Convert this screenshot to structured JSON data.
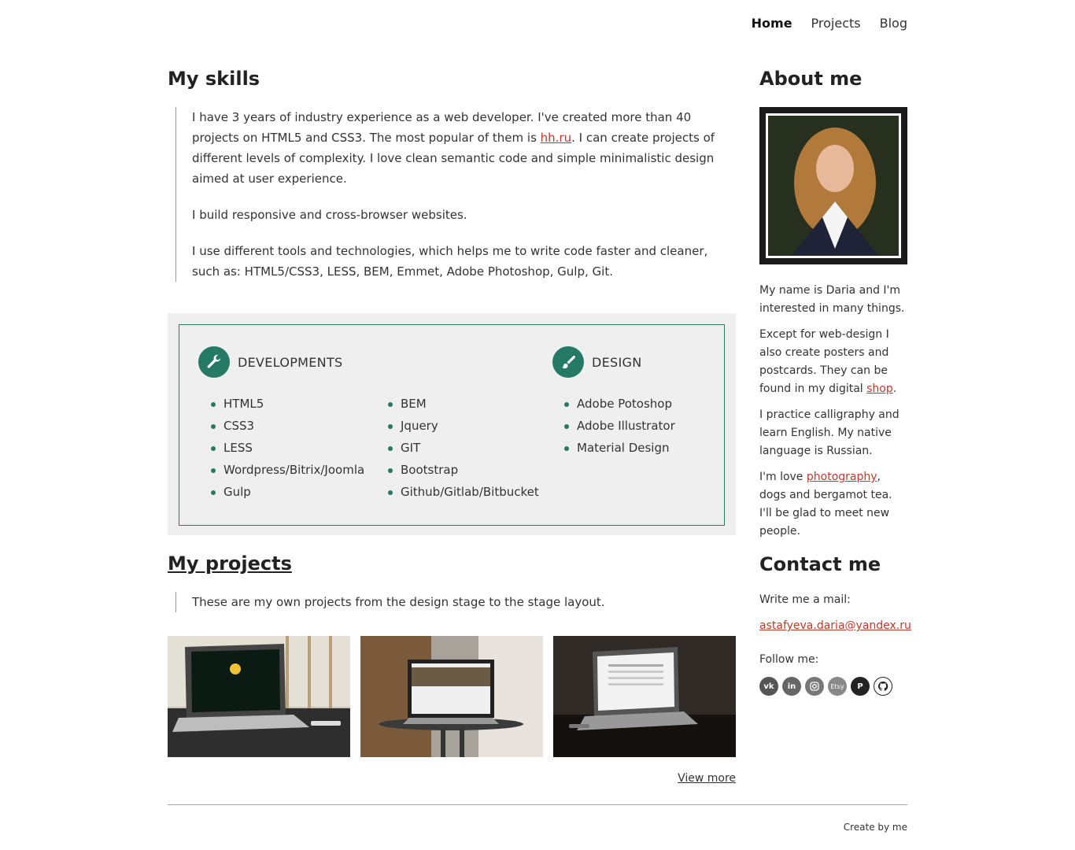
{
  "nav": {
    "home": "Home",
    "projects": "Projects",
    "blog": "Blog"
  },
  "skills": {
    "title": "My skills",
    "p1_before": "I have 3 years of industry experience as a web developer. I've created more than 40 projects on HTML5 and CSS3. The most popular of them is ",
    "p1_link": "hh.ru",
    "p1_after": ". I can create projects of different levels of complexity. I love clean semantic code and simple minimalistic design aimed at user experience.",
    "p2": "I build responsive and cross-browser websites.",
    "p3": "I use different tools and technologies, which helps me to write code faster and cleaner, such as: HTML5/CSS3, LESS, BEM, Emmet, Adobe Photoshop, Gulp, Git."
  },
  "box": {
    "dev_title": "DEVELOPMENTS",
    "design_title": "DESIGN",
    "dev_col1": [
      "HTML5",
      "CSS3",
      "LESS",
      "Wordpress/Bitrix/Joomla",
      "Gulp"
    ],
    "dev_col2": [
      "BEM",
      "Jquery",
      "GIT",
      "Bootstrap",
      "Github/Gitlab/Bitbucket"
    ],
    "design": [
      "Adobe Potoshop",
      "Adobe Illustrator",
      "Material Design"
    ],
    "accent": "#247a65"
  },
  "projects": {
    "title": "My projects",
    "desc": "These are my own projects from the design stage to the stage layout.",
    "more": "View more"
  },
  "about": {
    "title": "About me",
    "p1": "My name is Daria and I'm interested in many things.",
    "p2_before": "Except for web-design I also create posters and postcards. They can be found in my digital ",
    "p2_link": "shop",
    "p2_after": ".",
    "p3": "I practice calligraphy and learn English. My native language is Russian.",
    "p4_before": "I'm love ",
    "p4_link": "photography",
    "p4_after": ", dogs and bergamot tea. I'll be glad to meet new people."
  },
  "contact": {
    "title": "Contact me",
    "mail_label": "Write me a mail:",
    "email": "astafyeva.daria@yandex.ru",
    "follow": "Follow me:",
    "etsy": "Etsy"
  },
  "footer": {
    "text": "Create by me"
  }
}
